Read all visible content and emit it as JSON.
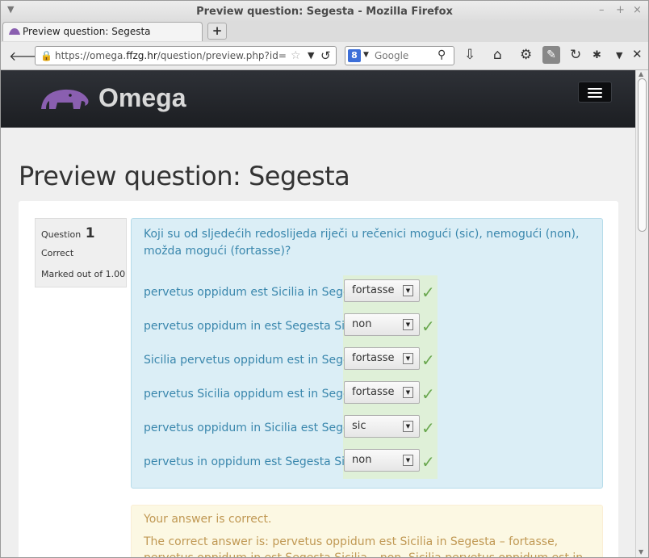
{
  "window": {
    "title": "Preview question: Segesta - Mozilla Firefox",
    "controls": [
      "–",
      "+",
      "×"
    ]
  },
  "tabs": [
    {
      "label": "Preview question: Segesta"
    }
  ],
  "new_tab_label": "+",
  "navbar": {
    "url_host_prefix": "https://omega.",
    "url_host_bold": "ffzg.hr",
    "url_path": "/question/preview.php?id=",
    "search_placeholder": "Google",
    "search_engine_letter": "8"
  },
  "site": {
    "logo_text": "Omega"
  },
  "page": {
    "heading": "Preview question: Segesta"
  },
  "question": {
    "number_label": "Question",
    "number": "1",
    "state": "Correct",
    "grade": "Marked out of 1.00",
    "text": "Koji su od sljedećih redoslijeda riječi u rečenici mogući (sic), nemogući (non), možda mogući (fortasse)?",
    "rows": [
      {
        "phrase": "pervetus oppidum est Sicilia in Segesta",
        "answer": "fortasse",
        "correct": true
      },
      {
        "phrase": "pervetus oppidum in est Segesta Sicilia",
        "answer": "non",
        "correct": true
      },
      {
        "phrase": "Sicilia pervetus oppidum est in Segesta",
        "answer": "fortasse",
        "correct": true
      },
      {
        "phrase": "pervetus Sicilia oppidum est in Segesta",
        "answer": "fortasse",
        "correct": true
      },
      {
        "phrase": "pervetus oppidum in Sicilia est Segesta",
        "answer": "sic",
        "correct": true
      },
      {
        "phrase": "pervetus in oppidum est Segesta Sicilia",
        "answer": "non",
        "correct": true
      }
    ]
  },
  "feedback": {
    "general": "Your answer is correct.",
    "right_answer": "The correct answer is: pervetus oppidum est Sicilia in Segesta – fortasse, pervetus oppidum in est Segesta Sicilia – non, Sicilia pervetus oppidum est in Segesta"
  },
  "colors": {
    "info_text": "#3a87ad",
    "correct_bg": "#dff0d8",
    "check": "#6aa84f",
    "outcome_text": "#c09853",
    "logo_purple": "#8a5fb0"
  }
}
